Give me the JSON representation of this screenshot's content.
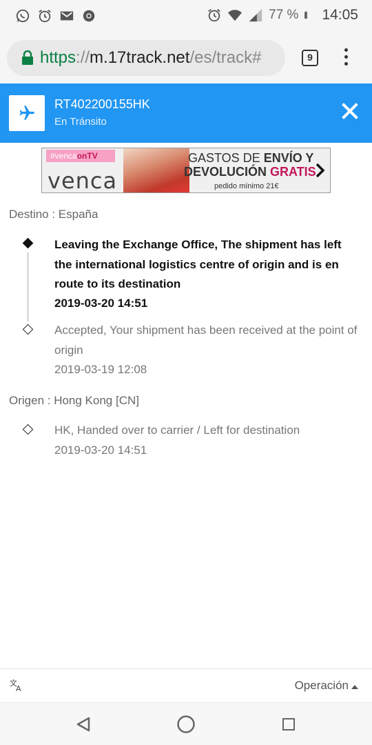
{
  "status_bar": {
    "battery_percent": "77 %",
    "time": "14:05",
    "left_icons": [
      "whatsapp-icon",
      "alarm-icon",
      "gmail-icon",
      "chrome-icon"
    ],
    "right_icons": [
      "alarm-icon",
      "wifi-icon",
      "signal-icon",
      "battery-icon"
    ]
  },
  "browser": {
    "url_scheme": "https",
    "url_sep": "://",
    "url_host": "m.17track.net",
    "url_path": "/es/track#",
    "tab_count": "9"
  },
  "header": {
    "tracking_number": "RT402200155HK",
    "status": "En Tránsito",
    "accent_color": "#2196f3"
  },
  "ad": {
    "tag_brand": "#venca",
    "tag_suffix": "onTV",
    "brand": "venca",
    "line1_prefix": "GASTOS DE ",
    "line1_bold": "ENVÍO Y",
    "line2_prefix": "DEVOLUCIÓN ",
    "line2_pink": "GRATIS",
    "line3": "pedido mínimo 21€"
  },
  "destination": {
    "label": "Destino : España",
    "events": [
      {
        "text": "Leaving the Exchange Office, The shipment has left the international logistics centre of origin and is en route to its destination",
        "date": "2019-03-20 14:51"
      },
      {
        "text": "Accepted, Your shipment has been received at the point of origin",
        "date": "2019-03-19 12:08"
      }
    ]
  },
  "origin": {
    "label": "Origen : Hong Kong [CN]",
    "events": [
      {
        "text": "HK, Handed over to carrier / Left for destination",
        "date": "2019-03-20 14:51"
      }
    ]
  },
  "operation_bar": {
    "label": "Operación"
  }
}
